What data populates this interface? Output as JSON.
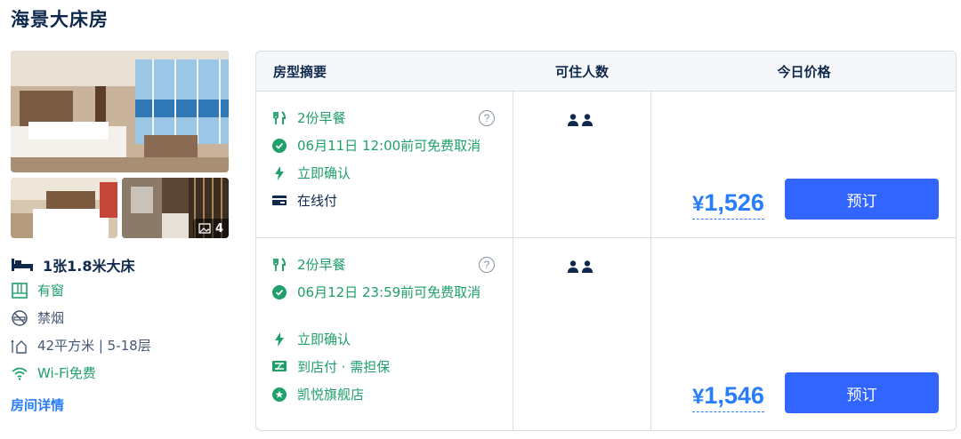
{
  "room": {
    "title": "海景大床房",
    "photo_count": "4",
    "bed": "1张1.8米大床",
    "window": "有窗",
    "smoking": "禁烟",
    "area": "42平方米 | 5-18层",
    "wifi": "Wi-Fi免费",
    "details_link": "房间详情"
  },
  "table": {
    "headers": {
      "summary": "房型摘要",
      "guests": "可住人数",
      "price": "今日价格"
    },
    "rows": [
      {
        "breakfast": "2份早餐",
        "cancel": "06月11日 12:00前可免费取消",
        "confirm": "立即确认",
        "payment": "在线付",
        "price": "1,526",
        "currency": "¥",
        "book_label": "预订"
      },
      {
        "breakfast": "2份早餐",
        "cancel": "06月12日 23:59前可免费取消",
        "confirm": "立即确认",
        "payment": "到店付 · 需担保",
        "extra": "凯悦旗舰店",
        "price": "1,546",
        "currency": "¥",
        "book_label": "预订"
      }
    ]
  },
  "colors": {
    "green": "#1f9f6a",
    "blue": "#287dfa",
    "button": "#3264ff",
    "text": "#0f294d"
  }
}
